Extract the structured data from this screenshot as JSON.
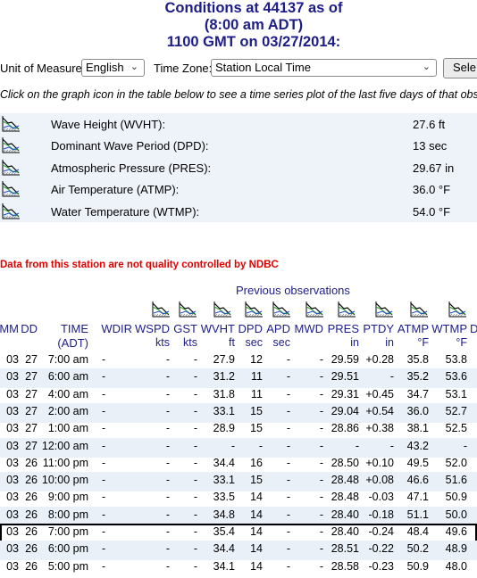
{
  "title": {
    "line1": "Conditions at 44137 as of",
    "line2": "(8:00 am ADT)",
    "line3": "1100 GMT on 03/27/2014:"
  },
  "controls": {
    "unit_label": "Unit of Measure:",
    "unit_value": "English",
    "tz_label": "Time Zone:",
    "tz_value": "Station Local Time",
    "select_button": "Sele"
  },
  "instructions": "Click on the graph icon in the table below to see a time series plot of the last five days of that obser",
  "conditions": [
    {
      "name": "Wave Height (WVHT):",
      "value": "27.6 ft"
    },
    {
      "name": "Dominant Wave Period (DPD):",
      "value": "13 sec"
    },
    {
      "name": "Atmospheric Pressure (PRES):",
      "value": "29.67 in"
    },
    {
      "name": "Air Temperature (ATMP):",
      "value": "36.0 °F"
    },
    {
      "name": "Water Temperature (WTMP):",
      "value": "54.0 °F"
    }
  ],
  "warning": "Data from this station are not quality controlled by NDBC",
  "observations": {
    "title": "Previous observations",
    "headers": {
      "mm": "MM",
      "dd": "DD",
      "time": "TIME",
      "time_unit": "(ADT)",
      "wdir": "WDIR",
      "wspd": "WSPD",
      "gst": "GST",
      "wvht": "WVHT",
      "dpd": "DPD",
      "apd": "APD",
      "mwd": "MWD",
      "pres": "PRES",
      "ptdy": "PTDY",
      "atmp": "ATMP",
      "wtmp": "WTMP",
      "dewp": "D"
    },
    "units": {
      "wspd": "kts",
      "gst": "kts",
      "wvht": "ft",
      "dpd": "sec",
      "apd": "sec",
      "pres": "in",
      "ptdy": "in",
      "atmp": "°F",
      "wtmp": "°F"
    },
    "rows": [
      {
        "mm": "03",
        "dd": "27",
        "time": "7:00 am",
        "wdir": "-",
        "wspd": "-",
        "gst": "-",
        "wvht": "27.9",
        "dpd": "12",
        "apd": "-",
        "mwd": "-",
        "pres": "29.59",
        "ptdy": "+0.28",
        "atmp": "35.8",
        "wtmp": "53.8"
      },
      {
        "mm": "03",
        "dd": "27",
        "time": "6:00 am",
        "wdir": "-",
        "wspd": "-",
        "gst": "-",
        "wvht": "31.2",
        "dpd": "11",
        "apd": "-",
        "mwd": "-",
        "pres": "29.51",
        "ptdy": "-",
        "atmp": "35.2",
        "wtmp": "53.6"
      },
      {
        "mm": "03",
        "dd": "27",
        "time": "4:00 am",
        "wdir": "-",
        "wspd": "-",
        "gst": "-",
        "wvht": "31.8",
        "dpd": "11",
        "apd": "-",
        "mwd": "-",
        "pres": "29.31",
        "ptdy": "+0.45",
        "atmp": "34.7",
        "wtmp": "53.1"
      },
      {
        "mm": "03",
        "dd": "27",
        "time": "2:00 am",
        "wdir": "-",
        "wspd": "-",
        "gst": "-",
        "wvht": "33.1",
        "dpd": "15",
        "apd": "-",
        "mwd": "-",
        "pres": "29.04",
        "ptdy": "+0.54",
        "atmp": "36.0",
        "wtmp": "52.7"
      },
      {
        "mm": "03",
        "dd": "27",
        "time": "1:00 am",
        "wdir": "-",
        "wspd": "-",
        "gst": "-",
        "wvht": "28.9",
        "dpd": "15",
        "apd": "-",
        "mwd": "-",
        "pres": "28.86",
        "ptdy": "+0.38",
        "atmp": "38.1",
        "wtmp": "52.5"
      },
      {
        "mm": "03",
        "dd": "27",
        "time": "12:00 am",
        "wdir": "-",
        "wspd": "-",
        "gst": "-",
        "wvht": "-",
        "dpd": "-",
        "apd": "-",
        "mwd": "-",
        "pres": "-",
        "ptdy": "-",
        "atmp": "43.2",
        "wtmp": "-"
      },
      {
        "mm": "03",
        "dd": "26",
        "time": "11:00 pm",
        "wdir": "-",
        "wspd": "-",
        "gst": "-",
        "wvht": "34.4",
        "dpd": "16",
        "apd": "-",
        "mwd": "-",
        "pres": "28.50",
        "ptdy": "+0.10",
        "atmp": "49.5",
        "wtmp": "52.0"
      },
      {
        "mm": "03",
        "dd": "26",
        "time": "10:00 pm",
        "wdir": "-",
        "wspd": "-",
        "gst": "-",
        "wvht": "33.1",
        "dpd": "15",
        "apd": "-",
        "mwd": "-",
        "pres": "28.48",
        "ptdy": "+0.08",
        "atmp": "46.6",
        "wtmp": "51.6"
      },
      {
        "mm": "03",
        "dd": "26",
        "time": "9:00 pm",
        "wdir": "-",
        "wspd": "-",
        "gst": "-",
        "wvht": "33.5",
        "dpd": "14",
        "apd": "-",
        "mwd": "-",
        "pres": "28.48",
        "ptdy": "-0.03",
        "atmp": "47.1",
        "wtmp": "50.9"
      },
      {
        "mm": "03",
        "dd": "26",
        "time": "8:00 pm",
        "wdir": "-",
        "wspd": "-",
        "gst": "-",
        "wvht": "34.8",
        "dpd": "14",
        "apd": "-",
        "mwd": "-",
        "pres": "28.40",
        "ptdy": "-0.18",
        "atmp": "51.1",
        "wtmp": "50.0"
      },
      {
        "mm": "03",
        "dd": "26",
        "time": "7:00 pm",
        "wdir": "-",
        "wspd": "-",
        "gst": "-",
        "wvht": "35.4",
        "dpd": "14",
        "apd": "-",
        "mwd": "-",
        "pres": "28.40",
        "ptdy": "-0.24",
        "atmp": "48.4",
        "wtmp": "49.6"
      },
      {
        "mm": "03",
        "dd": "26",
        "time": "6:00 pm",
        "wdir": "-",
        "wspd": "-",
        "gst": "-",
        "wvht": "34.4",
        "dpd": "14",
        "apd": "-",
        "mwd": "-",
        "pres": "28.51",
        "ptdy": "-0.22",
        "atmp": "50.2",
        "wtmp": "48.9"
      },
      {
        "mm": "03",
        "dd": "26",
        "time": "5:00 pm",
        "wdir": "-",
        "wspd": "-",
        "gst": "-",
        "wvht": "34.1",
        "dpd": "14",
        "apd": "-",
        "mwd": "-",
        "pres": "28.58",
        "ptdy": "-0.23",
        "atmp": "50.9",
        "wtmp": "48.0"
      }
    ],
    "selected_row": 10
  },
  "icon_name": "graph-icon",
  "colors": {
    "title": "#1d1d88",
    "warning": "#e00000",
    "row_alt": "#e9f0f8",
    "panel": "#eef3fa"
  }
}
